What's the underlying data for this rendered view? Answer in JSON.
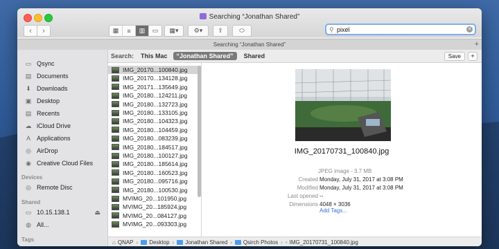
{
  "window": {
    "title": "Searching “Jonathan Shared”",
    "tab_label": "Searching “Jonathan Shared”"
  },
  "toolbar": {
    "back_icon": "chevron-left-icon",
    "forward_icon": "chevron-right-icon",
    "view_modes": [
      "icon-view",
      "list-view",
      "column-view",
      "gallery-view"
    ],
    "active_view": "column-view"
  },
  "search": {
    "value": "pixel"
  },
  "scope": {
    "label": "Search:",
    "this_mac": "This Mac",
    "current": "“Jonathan Shared”",
    "shared": "Shared",
    "save": "Save",
    "add": "+"
  },
  "sidebar": {
    "favorites": [
      {
        "label": "Qsync",
        "icon": "folder-icon"
      },
      {
        "label": "Documents",
        "icon": "document-icon"
      },
      {
        "label": "Downloads",
        "icon": "download-icon"
      },
      {
        "label": "Desktop",
        "icon": "desktop-icon"
      },
      {
        "label": "Recents",
        "icon": "recents-icon"
      },
      {
        "label": "iCloud Drive",
        "icon": "cloud-icon"
      },
      {
        "label": "Applications",
        "icon": "applications-icon"
      },
      {
        "label": "AirDrop",
        "icon": "airdrop-icon"
      },
      {
        "label": "Creative Cloud Files",
        "icon": "creative-cloud-icon"
      }
    ],
    "devices_header": "Devices",
    "devices": [
      {
        "label": "Remote Disc",
        "icon": "disc-icon"
      }
    ],
    "shared_header": "Shared",
    "shared": [
      {
        "label": "10.15.138.1",
        "icon": "server-icon",
        "eject": "⏏"
      },
      {
        "label": "All...",
        "icon": "network-icon"
      }
    ],
    "tags_header": "Tags"
  },
  "files": [
    "IMG_20170...100840.jpg",
    "IMG_20170...134128.jpg",
    "IMG_20171...135649.jpg",
    "IMG_20180...124211.jpg",
    "IMG_20180...132723.jpg",
    "IMG_20180...133105.jpg",
    "IMG_20180...104323.jpg",
    "IMG_20180...104459.jpg",
    "IMG_20180...083239.jpg",
    "IMG_20180...184517.jpg",
    "IMG_20180...100127.jpg",
    "IMG_20180...185614.jpg",
    "IMG_20180...160523.jpg",
    "IMG_20180...095716.jpg",
    "IMG_20180...100530.jpg",
    "MVIMG_20...101950.jpg",
    "MVIMG_20...185924.jpg",
    "MVIMG_20...084127.jpg",
    "MVIMG_20...093303.jpg"
  ],
  "selected_index": 0,
  "preview": {
    "filename": "IMG_20170731_100840.jpg",
    "type": "JPEG image - 3.7 MB",
    "metadata": [
      {
        "label": "Created",
        "value": "Monday, July 31, 2017 at 3:08 PM"
      },
      {
        "label": "Modified",
        "value": "Monday, July 31, 2017 at 3:08 PM"
      },
      {
        "label": "Last opened",
        "value": "--"
      },
      {
        "label": "Dimensions",
        "value": "4048 × 3036"
      }
    ],
    "add_tags": "Add Tags..."
  },
  "pathbar": [
    "QNAP",
    "Desktop",
    "Jonathan Shared",
    "Qsirch Photos",
    "IMG_20170731_100840.jpg"
  ]
}
